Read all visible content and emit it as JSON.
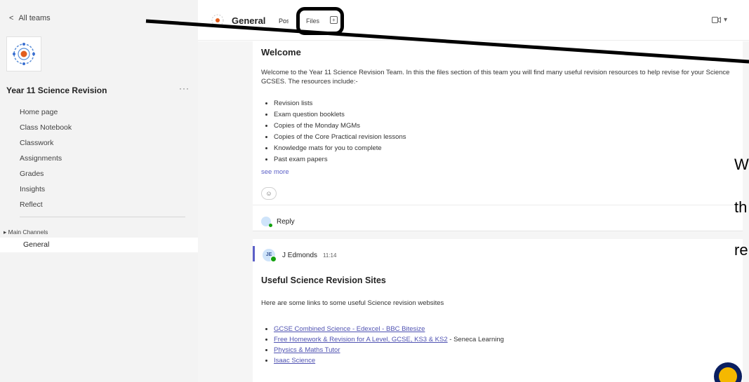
{
  "sidebar": {
    "back_label": "All teams",
    "team_name": "Year 11 Science Revision",
    "more_label": "···",
    "nav_items": [
      "Home page",
      "Class Notebook",
      "Classwork",
      "Assignments",
      "Grades",
      "Insights",
      "Reflect"
    ],
    "channels_header": "Main Channels",
    "channels": [
      "General"
    ]
  },
  "header": {
    "channel_title": "General",
    "tabs": [
      "Posts",
      "Files"
    ],
    "add_tab": "+",
    "meet_label": "▾"
  },
  "post1": {
    "title": "Welcome",
    "body": "Welcome to the Year 11 Science Revision Team. In this the files section of this team you will find many useful revision resources to help revise for your Science GCSES. The resources include:-",
    "items": [
      "Revision lists",
      "Exam question booklets",
      "Copies of the Monday MGMs",
      "Copies of the Core Practical revision lessons",
      "Knowledge mats for you to complete",
      "Past exam papers"
    ],
    "see_more": "see more",
    "reply_label": "Reply"
  },
  "post2": {
    "author_initials": "JE",
    "author": "J Edmonds",
    "time": "11:14",
    "title": "Useful Science Revision Sites",
    "body": "Here are some links to some useful Science revision websites",
    "links": [
      {
        "text": "GCSE Combined Science - Edexcel - BBC Bitesize",
        "suffix": ""
      },
      {
        "text": "Free Homework & Revision for A Level, GCSE, KS3 & KS2",
        "suffix": " - Seneca Learning"
      },
      {
        "text": "Physics & Maths Tutor",
        "suffix": ""
      },
      {
        "text": "Isaac Science",
        "suffix": ""
      }
    ]
  },
  "overlay": {
    "lines": [
      "W",
      "th",
      "re"
    ],
    "annotation_color": "#000000"
  }
}
